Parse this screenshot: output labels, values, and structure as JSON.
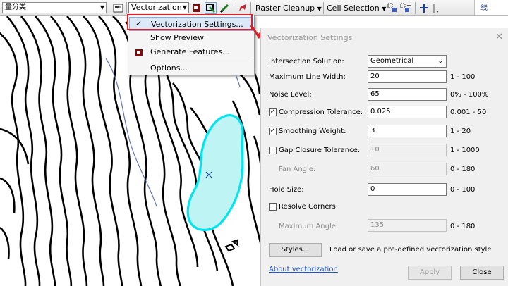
{
  "toolbar": {
    "left_combo": "量分类",
    "vectorization_label": "Vectorization",
    "raster_cleanup_label": "Raster Cleanup",
    "cell_selection_label": "Cell Selection",
    "right_tab_label": "线"
  },
  "menu": {
    "items": [
      {
        "label": "Vectorization Settings...",
        "checked": true,
        "icon": "check-icon"
      },
      {
        "label": "Show Preview",
        "icon": ""
      },
      {
        "label": "Generate Features...",
        "icon": "generate-features-icon"
      },
      {
        "label": "Options...",
        "icon": ""
      }
    ]
  },
  "dialog": {
    "title": "Vectorization Settings",
    "intersection_solution": {
      "label": "Intersection Solution:",
      "value": "Geometrical"
    },
    "max_line_width": {
      "label": "Maximum Line Width:",
      "value": "20",
      "range": "1 - 100"
    },
    "noise_level": {
      "label": "Noise Level:",
      "value": "65",
      "range": "0% - 100%"
    },
    "compression_tolerance": {
      "label": "Compression Tolerance:",
      "value": "0.025",
      "range": "0.001 - 50",
      "checked": true
    },
    "smoothing_weight": {
      "label": "Smoothing Weight:",
      "value": "3",
      "range": "1 - 20",
      "checked": true
    },
    "gap_closure_tolerance": {
      "label": "Gap Closure Tolerance:",
      "value": "10",
      "range": "1 - 1000",
      "checked": false
    },
    "fan_angle": {
      "label": "Fan Angle:",
      "value": "60",
      "range": "0 - 180"
    },
    "hole_size": {
      "label": "Hole Size:",
      "value": "0",
      "range": "0 - 100"
    },
    "resolve_corners": {
      "label": "Resolve Corners",
      "checked": false
    },
    "maximum_angle": {
      "label": "Maximum Angle:",
      "value": "135",
      "range": "0 - 180"
    },
    "styles_button": "Styles...",
    "styles_desc": "Load or save a pre-defined vectorization style",
    "about_link": "About vectorization",
    "apply_button": "Apply",
    "close_button": "Close"
  },
  "colors": {
    "highlight_red": "#d8212c",
    "selection_cyan": "#00e5f0",
    "selection_fill": "#bff4f4",
    "link_blue": "#1f55c6"
  }
}
